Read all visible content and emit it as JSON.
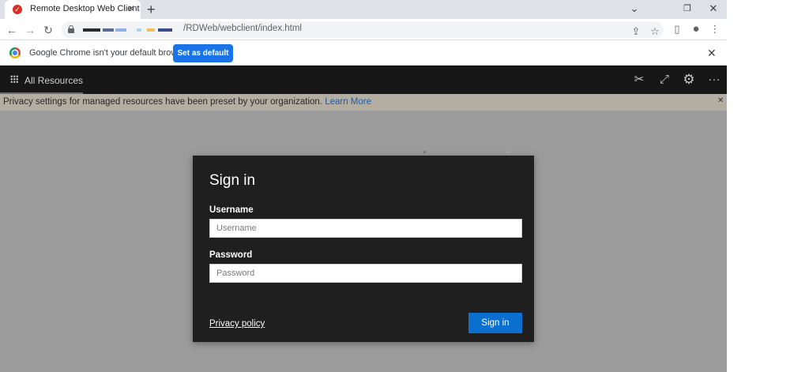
{
  "browser": {
    "tab": {
      "title": "Remote Desktop Web Client",
      "close": "✕"
    },
    "new_tab": "+",
    "window_controls": {
      "minimize": "⌄",
      "restore": "❐",
      "close": "✕"
    },
    "toolbar": {
      "back": "←",
      "forward": "→",
      "reload": "↻",
      "url_path": "/RDWeb/webclient/index.html",
      "share_icon": "⇪",
      "bookmark_star": "☆",
      "side_panel": "▯",
      "profile": "●",
      "menu": "⋮"
    },
    "infobar": {
      "message": "Google Chrome isn't your default browser",
      "button": "Set as default",
      "close": "✕"
    }
  },
  "app": {
    "nav": {
      "all_resources": "All Resources"
    },
    "header_icons": {
      "pin": "✂",
      "fullscreen": "⤢",
      "settings": "⚙",
      "more": "···"
    },
    "privacy_banner": {
      "text": "Privacy settings for managed resources have been preset by your organization.",
      "link": "Learn More",
      "close": "✕"
    },
    "signin": {
      "title": "Sign in",
      "username_label": "Username",
      "username_placeholder": "Username",
      "password_label": "Password",
      "password_placeholder": "Password",
      "privacy_policy": "Privacy policy",
      "submit": "Sign in"
    }
  },
  "colors": {
    "accent_blue": "#1a73e8",
    "signin_blue": "#0b6fcf",
    "app_header": "#171717",
    "dialog_bg": "#1f1f1f",
    "banner": "#b3ada2"
  }
}
